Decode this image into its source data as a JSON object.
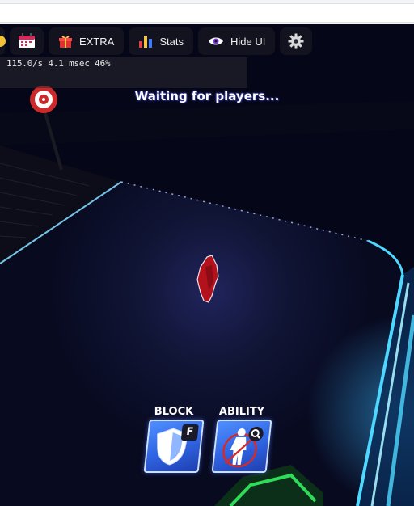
{
  "toolbar": {
    "calendar_icon": "calendar-icon",
    "extra_label": "EXTRA",
    "stats_label": "Stats",
    "hide_ui_label": "Hide UI",
    "settings_icon": "gear-icon"
  },
  "perf": {
    "readout": "115.0/s 4.1 msec 46%"
  },
  "status": {
    "message": "Waiting for players..."
  },
  "abilities": [
    {
      "label": "BLOCK",
      "key": "F",
      "icon": "shield-icon"
    },
    {
      "label": "ABILITY",
      "key": "",
      "icon": "character-search-icon"
    }
  ],
  "colors": {
    "accent_neon": "#4fd8ff",
    "tile_blue": "#3a72f0",
    "player_red": "#b3121c",
    "target_red": "#d62a2a"
  }
}
